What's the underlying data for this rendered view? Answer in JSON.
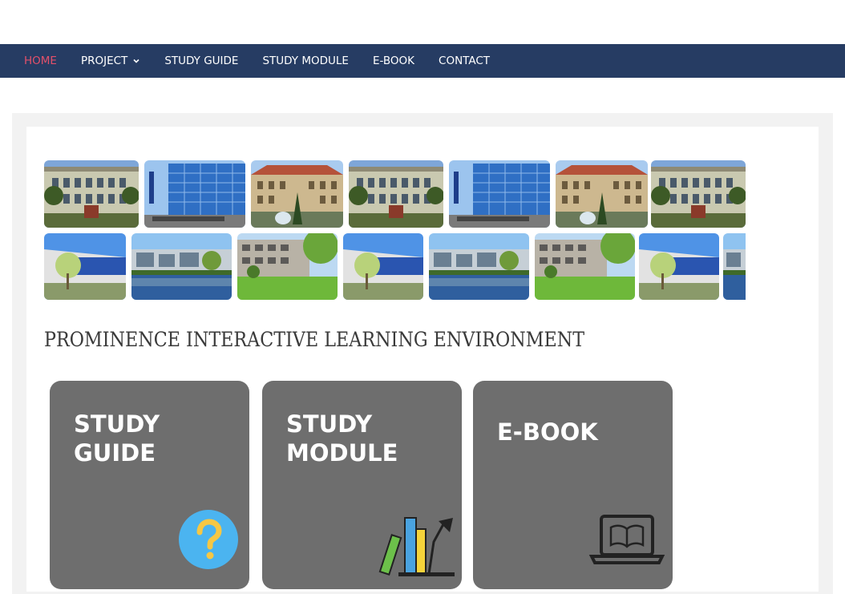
{
  "nav": {
    "items": [
      {
        "label": "HOME",
        "active": true
      },
      {
        "label": "PROJECT",
        "has_dropdown": true
      },
      {
        "label": "STUDY GUIDE"
      },
      {
        "label": "STUDY MODULE"
      },
      {
        "label": "E-BOOK"
      },
      {
        "label": "CONTACT"
      }
    ],
    "bg_color": "#263c63",
    "active_color": "#e3506a"
  },
  "gallery": {
    "row1": [
      "campus-building-photo",
      "glass-building-photo",
      "university-hall-photo",
      "campus-building-photo",
      "glass-building-photo",
      "university-hall-photo",
      "campus-building-photo"
    ],
    "row2": [
      "campus-modern-photo",
      "pond-buildings-photo",
      "lawn-buildings-photo",
      "campus-modern-photo",
      "pond-buildings-photo",
      "lawn-buildings-photo",
      "campus-modern-photo",
      "pond-buildings-photo"
    ]
  },
  "main": {
    "title": "PROMINENCE INTERACTIVE LEARNING ENVIRONMENT"
  },
  "cards": [
    {
      "label_line1": "STUDY",
      "label_line2": "GUIDE",
      "icon": "question-icon",
      "color": "#6e6e6e"
    },
    {
      "label_line1": "STUDY",
      "label_line2": "MODULE",
      "icon": "books-icon",
      "color": "#6e6e6e"
    },
    {
      "label_line1": "E-BOOK",
      "label_line2": "",
      "icon": "laptop-book-icon",
      "color": "#6e6e6e"
    }
  ]
}
